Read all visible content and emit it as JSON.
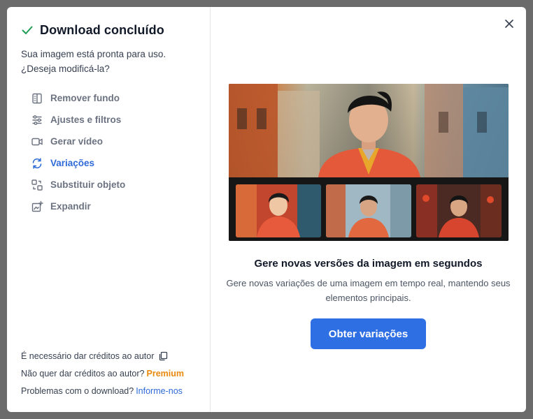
{
  "dialog": {
    "title": "Download concluído",
    "subtitle": "Sua imagem está pronta para uso. ¿Deseja modificá-la?",
    "menu": [
      {
        "label": "Remover fundo",
        "icon": "remove-background-icon",
        "active": false
      },
      {
        "label": "Ajustes e filtros",
        "icon": "sliders-icon",
        "active": false
      },
      {
        "label": "Gerar vídeo",
        "icon": "video-camera-icon",
        "active": false
      },
      {
        "label": "Variações",
        "icon": "refresh-icon",
        "active": true
      },
      {
        "label": "Substituir objeto",
        "icon": "replace-object-icon",
        "active": false
      },
      {
        "label": "Expandir",
        "icon": "expand-image-icon",
        "active": false
      }
    ],
    "footer": {
      "credit_text": "É necessário dar créditos ao autor",
      "premium_prefix": "Não quer dar créditos ao autor?",
      "premium_link": "Premium",
      "report_prefix": "Problemas com o download?",
      "report_link": "Informe-nos"
    }
  },
  "panel": {
    "heading": "Gere novas versões da imagem em segundos",
    "description": "Gere novas variações de uma imagem em tempo real, mantendo seus elementos principais.",
    "cta_label": "Obter variações"
  },
  "colors": {
    "accent": "#2f6fe4",
    "active_link": "#2f6ad8",
    "premium": "#e8890c",
    "success_check": "#1f9d55"
  }
}
